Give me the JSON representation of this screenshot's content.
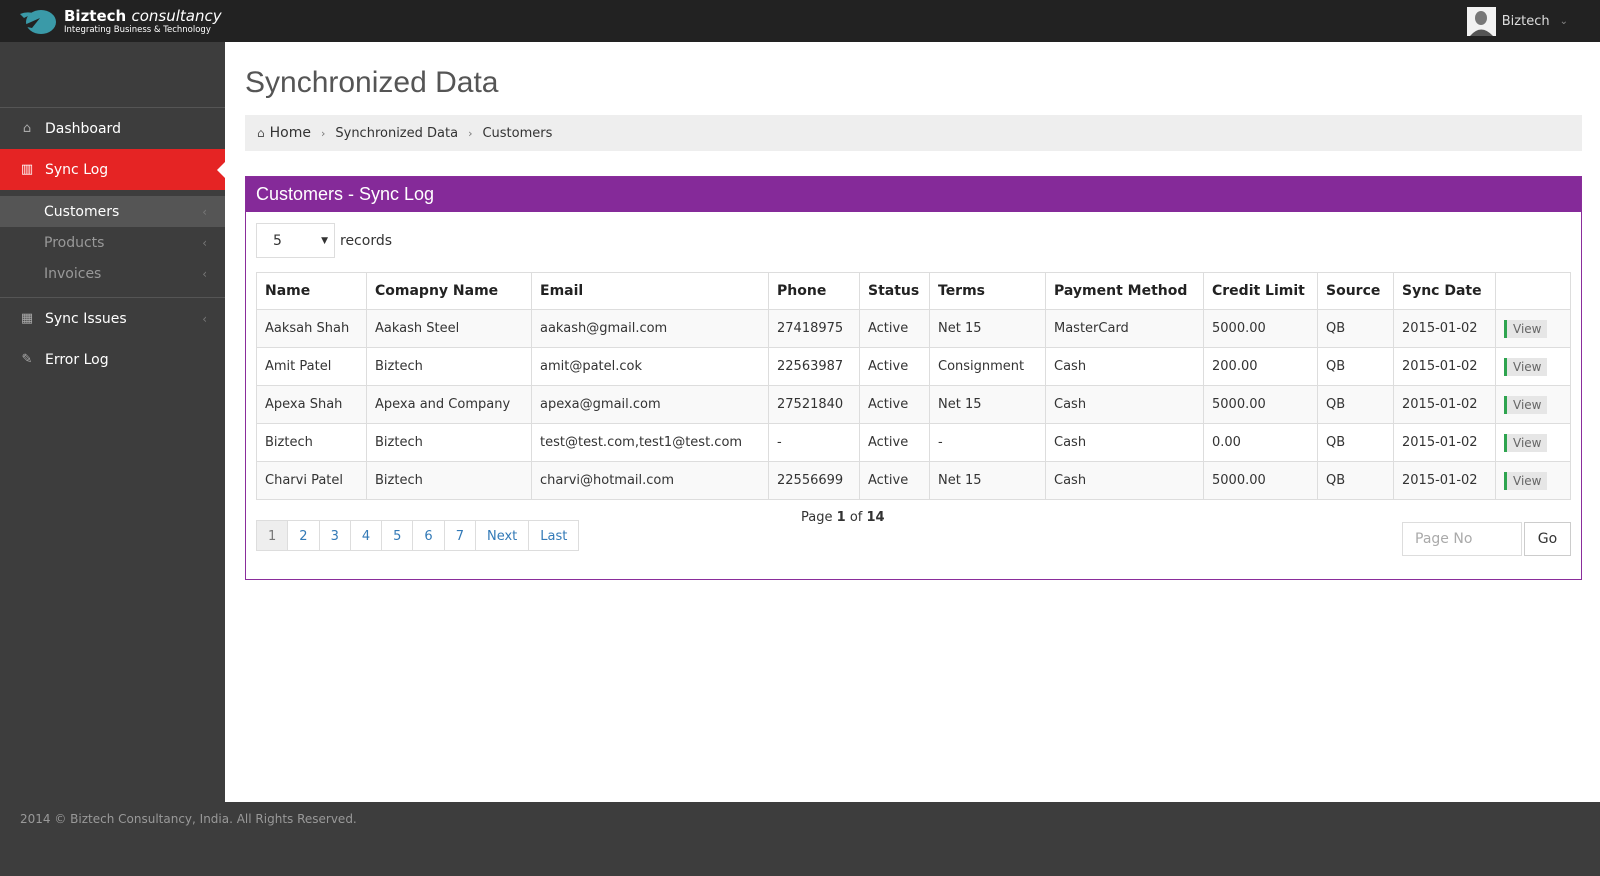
{
  "header": {
    "brand_title": "Biztech",
    "brand_title_italic": "consultancy",
    "brand_tagline": "Integrating Business & Technology",
    "user_name": "Biztech",
    "user_caret": "⌄"
  },
  "sidebar": {
    "items": [
      {
        "label": "Dashboard",
        "icon": "home-icon",
        "glyph": "⌂"
      },
      {
        "label": "Sync Log",
        "icon": "bar-chart-icon",
        "glyph": "▥",
        "active": true
      },
      {
        "label": "Sync Issues",
        "icon": "table-icon",
        "glyph": "▦"
      },
      {
        "label": "Error Log",
        "icon": "pencil-icon",
        "glyph": "✎"
      }
    ],
    "sub_items": [
      {
        "label": "Customers",
        "active": true
      },
      {
        "label": "Products"
      },
      {
        "label": "Invoices"
      }
    ],
    "arrow_glyph": "‹"
  },
  "page": {
    "title": "Synchronized Data",
    "breadcrumb": {
      "home": "Home",
      "items": [
        "Synchronized Data",
        "Customers"
      ],
      "separator": "›"
    }
  },
  "panel": {
    "title": "Customers - Sync Log",
    "records_value": "5",
    "records_label": "records",
    "columns": [
      "Name",
      "Comapny Name",
      "Email",
      "Phone",
      "Status",
      "Terms",
      "Payment Method",
      "Credit Limit",
      "Source",
      "Sync Date",
      ""
    ],
    "rows": [
      [
        "Aaksah Shah",
        "Aakash Steel",
        "aakash@gmail.com",
        "27418975",
        "Active",
        "Net 15",
        "MasterCard",
        "5000.00",
        "QB",
        "2015-01-02"
      ],
      [
        "Amit Patel",
        "Biztech",
        "amit@patel.cok",
        "22563987",
        "Active",
        "Consignment",
        "Cash",
        "200.00",
        "QB",
        "2015-01-02"
      ],
      [
        "Apexa Shah",
        "Apexa and Company",
        "apexa@gmail.com",
        "27521840",
        "Active",
        "Net 15",
        "Cash",
        "5000.00",
        "QB",
        "2015-01-02"
      ],
      [
        "Biztech",
        "Biztech",
        "test@test.com,test1@test.com",
        "-",
        "Active",
        "-",
        "Cash",
        "0.00",
        "QB",
        "2015-01-02"
      ],
      [
        "Charvi Patel",
        "Biztech",
        "charvi@hotmail.com",
        "22556699",
        "Active",
        "Net 15",
        "Cash",
        "5000.00",
        "QB",
        "2015-01-02"
      ]
    ],
    "view_label": "View",
    "pagination": {
      "pages": [
        "1",
        "2",
        "3",
        "4",
        "5",
        "6",
        "7"
      ],
      "current": "1",
      "next": "Next",
      "last": "Last",
      "info_prefix": "Page",
      "info_current": "1",
      "info_of": "of",
      "info_total": "14",
      "page_no_placeholder": "Page No",
      "go_label": "Go"
    }
  },
  "footer": {
    "text": "2014 © Biztech Consultancy, India. All Rights Reserved."
  },
  "colors": {
    "accent_red": "#e52424",
    "panel_purple": "#852a99",
    "view_green": "#2ea44f"
  }
}
